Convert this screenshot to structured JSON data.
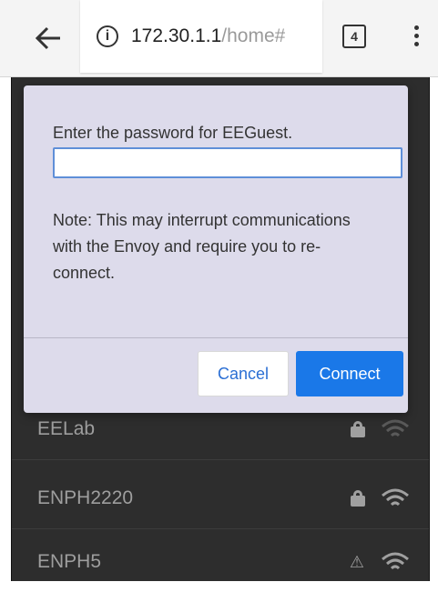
{
  "browser": {
    "url_host": "172.30.1.1",
    "url_path": "/home#",
    "tab_count": "4",
    "icons": {
      "back": "back-arrow-icon",
      "info": "info-icon",
      "menu": "more-vert-icon"
    }
  },
  "dialog": {
    "prompt": "Enter the password for EEGuest.",
    "password_value": "",
    "note": "Note: This may interrupt communications with the Envoy and require you to re-connect.",
    "cancel_label": "Cancel",
    "connect_label": "Connect"
  },
  "networks": [
    {
      "name": "EELab",
      "status_icon": "lock-icon",
      "signal_icon": "wifi-icon"
    },
    {
      "name": "ENPH2220",
      "status_icon": "lock-icon",
      "signal_icon": "wifi-icon"
    },
    {
      "name": "ENPH5",
      "status_icon": "warning-icon",
      "status_glyph": "⚠",
      "signal_icon": "wifi-icon"
    }
  ],
  "colors": {
    "dialog_bg": "#dddbeb",
    "page_bg": "#2d2d2d",
    "primary": "#1a78e8",
    "link": "#2b6fd4"
  }
}
